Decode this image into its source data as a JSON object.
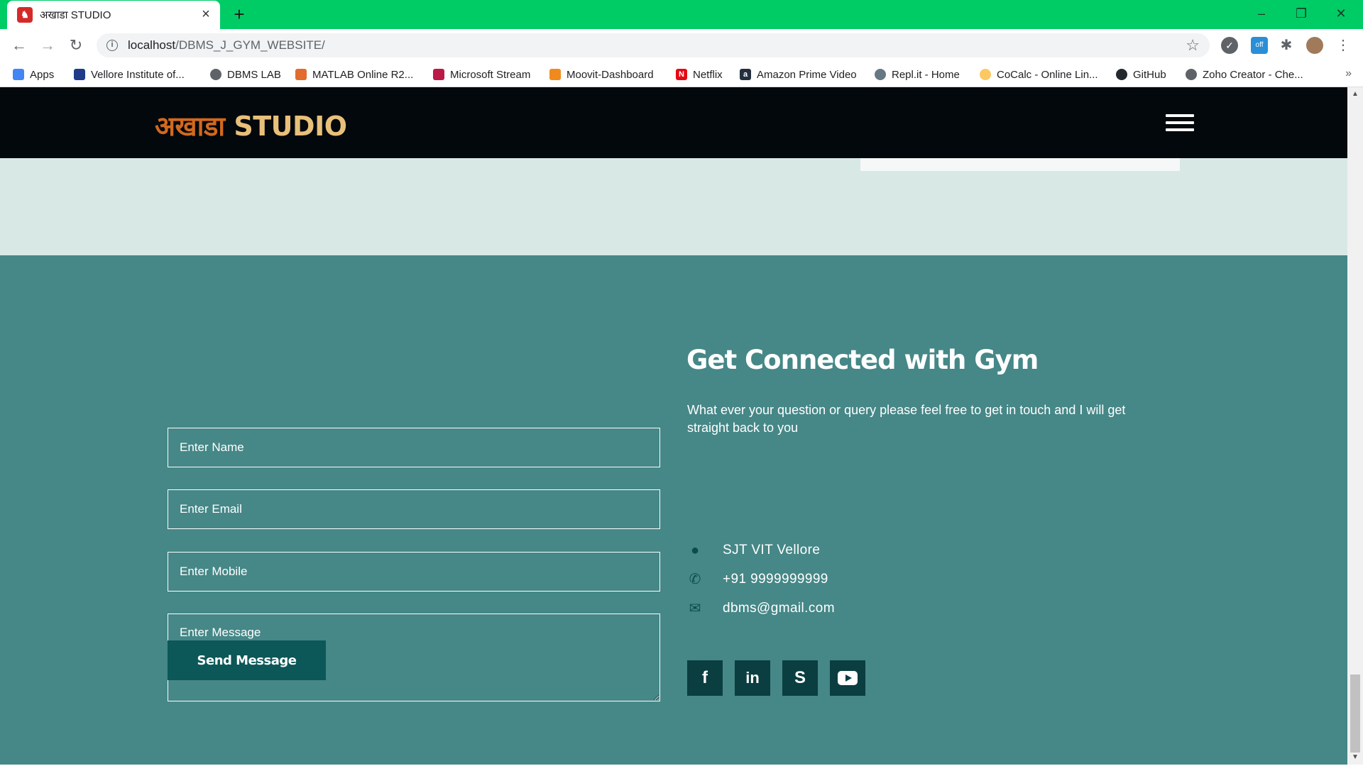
{
  "browser": {
    "tab_title": "अखाडा STUDIO",
    "url_host": "localhost",
    "url_path": "/DBMS_J_GYM_WEBSITE/",
    "bookmarks": [
      {
        "label": "Apps",
        "icon": "apps-grid-icon"
      },
      {
        "label": "Vellore Institute of...",
        "icon": "vit-icon"
      },
      {
        "label": "DBMS LAB",
        "icon": "globe-icon"
      },
      {
        "label": "MATLAB Online R2...",
        "icon": "matlab-icon"
      },
      {
        "label": "Microsoft Stream",
        "icon": "stream-icon"
      },
      {
        "label": "Moovit-Dashboard",
        "icon": "moovit-icon"
      },
      {
        "label": "Netflix",
        "icon": "netflix-icon"
      },
      {
        "label": "Amazon Prime Video",
        "icon": "amazon-icon"
      },
      {
        "label": "Repl.it - Home",
        "icon": "replit-icon"
      },
      {
        "label": "CoCalc - Online Lin...",
        "icon": "cocalc-icon"
      },
      {
        "label": "GitHub",
        "icon": "github-icon"
      },
      {
        "label": "Zoho Creator - Che...",
        "icon": "globe-icon"
      }
    ],
    "titlebar_color": "#00cc66"
  },
  "site": {
    "logo_hindi": "अखाडा",
    "logo_english": "STUDIO"
  },
  "contact_form": {
    "name_placeholder": "Enter Name",
    "email_placeholder": "Enter Email",
    "mobile_placeholder": "Enter Mobile",
    "message_placeholder": "Enter Message",
    "submit_label": "Send Message"
  },
  "contact_info": {
    "title": "Get Connected with Gym",
    "description": "What ever your question or query please feel free to get in touch and I will get straight back to you",
    "address": "SJT VIT Vellore",
    "phone": "+91 9999999999",
    "email": "dbms@gmail.com"
  },
  "social": [
    "facebook-icon",
    "linkedin-icon",
    "skype-icon",
    "youtube-icon"
  ],
  "colors": {
    "section_bg": "#468787",
    "button_bg": "#0c5758",
    "social_bg": "#0b3e40",
    "header_bg": "#02080c",
    "upper_bg": "#d8e9e5"
  }
}
